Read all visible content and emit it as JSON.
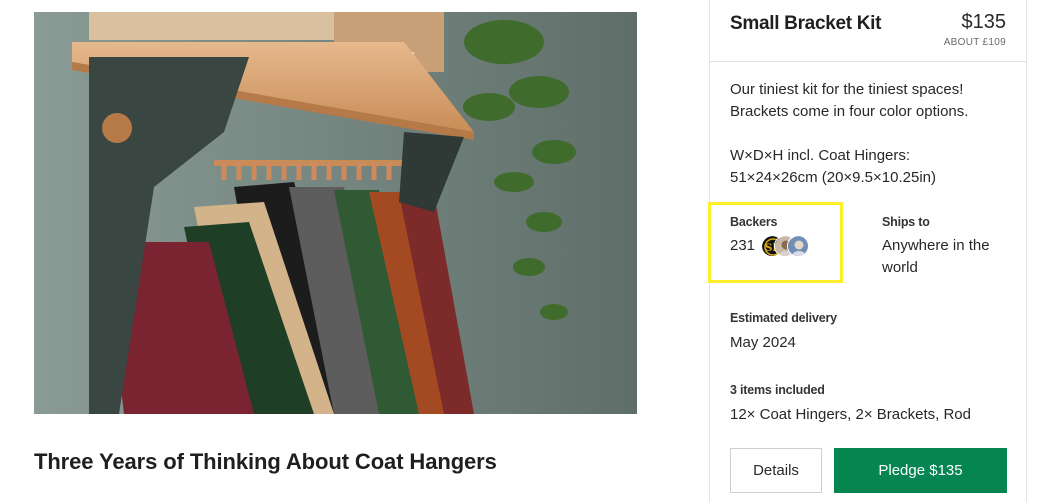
{
  "photo": {
    "alt_subject": "coat rack with wooden shelf, dark bracket and hanging clothes"
  },
  "post": {
    "title": "Three Years of Thinking About Coat Hangers"
  },
  "reward": {
    "title": "Small Bracket Kit",
    "price": "$135",
    "price_alt": "ABOUT £109",
    "description": "Our tiniest kit for the tiniest spaces! Brackets come in four color options.",
    "dimensions_label": "W×D×H incl. Coat Hingers:",
    "dimensions_value": "51×24×26cm (20×9.5×10.25in)",
    "backers": {
      "label": "Backers",
      "count": "231",
      "avatars": [
        "avatar-monogram-icon",
        "avatar-person-icon",
        "avatar-person-icon"
      ]
    },
    "ships_to": {
      "label": "Ships to",
      "value": "Anywhere in the world"
    },
    "delivery": {
      "label": "Estimated delivery",
      "value": "May 2024"
    },
    "included": {
      "label": "3 items included",
      "value": "12× Coat Hingers, 2× Brackets, Rod"
    },
    "buttons": {
      "details": "Details",
      "pledge": "Pledge $135"
    }
  },
  "colors": {
    "accent_green": "#05854f",
    "highlight_yellow": "#ffee2a",
    "bracket": "#3a4641",
    "wall": "#7f8f89"
  }
}
